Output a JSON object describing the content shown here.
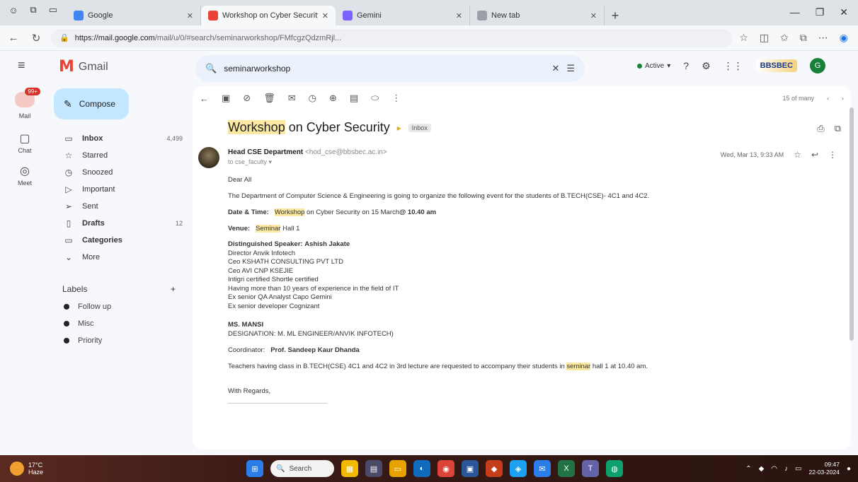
{
  "browser": {
    "tabs": [
      {
        "title": "Google",
        "favicon_color": "#4285f4",
        "active": false
      },
      {
        "title": "Workshop on Cyber Security – ...",
        "favicon_color": "#ea4335",
        "active": true
      },
      {
        "title": "Gemini",
        "favicon_color": "#7b61ff",
        "active": false
      },
      {
        "title": "New tab",
        "favicon_color": "#9aa0a6",
        "active": false
      }
    ],
    "url_domain": "https://mail.google.com",
    "url_path": "/mail/u/0/#search/seminarworkshop/FMfcgzQdzmRjl..."
  },
  "gmail": {
    "logo_text": "Gmail",
    "compose_label": "Compose",
    "rail": [
      {
        "label": "Mail",
        "badge": "99+"
      },
      {
        "label": "Chat"
      },
      {
        "label": "Meet"
      }
    ],
    "nav": [
      {
        "label": "Inbox",
        "count": "4,499",
        "icon": "inbox-icon",
        "bold": true
      },
      {
        "label": "Starred",
        "count": "",
        "icon": "star-icon",
        "bold": false
      },
      {
        "label": "Snoozed",
        "count": "",
        "icon": "clock-icon",
        "bold": false
      },
      {
        "label": "Important",
        "count": "",
        "icon": "important-icon",
        "bold": false
      },
      {
        "label": "Sent",
        "count": "",
        "icon": "send-icon",
        "bold": false
      },
      {
        "label": "Drafts",
        "count": "12",
        "icon": "draft-icon",
        "bold": true
      },
      {
        "label": "Categories",
        "count": "",
        "icon": "category-icon",
        "bold": true
      },
      {
        "label": "More",
        "count": "",
        "icon": "chevron-down-icon",
        "bold": false
      }
    ],
    "labels_heading": "Labels",
    "labels": [
      "Follow up",
      "Misc",
      "Priority"
    ],
    "search_value": "seminarworkshop",
    "status": "Active",
    "brand": "BBSBEC",
    "avatar_letter": "G"
  },
  "email": {
    "subject_hl": "Workshop",
    "subject_rest": " on Cyber Security",
    "tag": "Inbox",
    "sender_name": "Head CSE Department",
    "sender_email": "<hod_cse@bbsbec.ac.in>",
    "to": "to cse_faculty ▾",
    "date": "Wed, Mar 13, 9:33 AM",
    "pager": "15 of many",
    "greeting": "Dear All",
    "intro": "The Department of Computer Science & Engineering is going to organize the following event for the students of B.TECH(CSE)- 4C1 and 4C2.",
    "date_time_label": "Date & Time:",
    "date_time_hl": "Workshop",
    "date_time_rest": " on Cyber Security on 15 March",
    "date_time_bold": "@ 10.40 am",
    "venue_label": "Venue:",
    "venue_hl": "Seminar",
    "venue_rest": " Hall 1",
    "speaker_label": "Distinguished Speaker:",
    "speaker_name": "Ashish Jakate",
    "speaker_lines": [
      "Director Anvik Infotech",
      "Ceo KSHATH CONSULTING PVT LTD",
      "Ceo AVI CNP KSEJIE",
      "Intigri certified Shortle certified",
      "Having more than 10 years of experience in the field of IT",
      "Ex senior QA Analyst Capo Gemini",
      "Ex senior developer Cognizant"
    ],
    "ms_name": "MS. MANSI",
    "ms_designation": "DESIGNATION: M. ML ENGINEER/ANVIK INFOTECH)",
    "coordinator_label": "Coordinator:",
    "coordinator_name": "Prof. Sandeep Kaur Dhanda",
    "notice_a": "Teachers having class in B.TECH(CSE) 4C1 and 4C2 in 3rd lecture are requested to accompany their students in ",
    "notice_hl": "seminar",
    "notice_b": " hall 1 at 10.40 am.",
    "regards": "With Regards,"
  },
  "taskbar": {
    "weather_temp": "17°C",
    "weather_desc": "Haze",
    "search_label": "Search",
    "time": "09:47",
    "date": "22-03-2024"
  }
}
